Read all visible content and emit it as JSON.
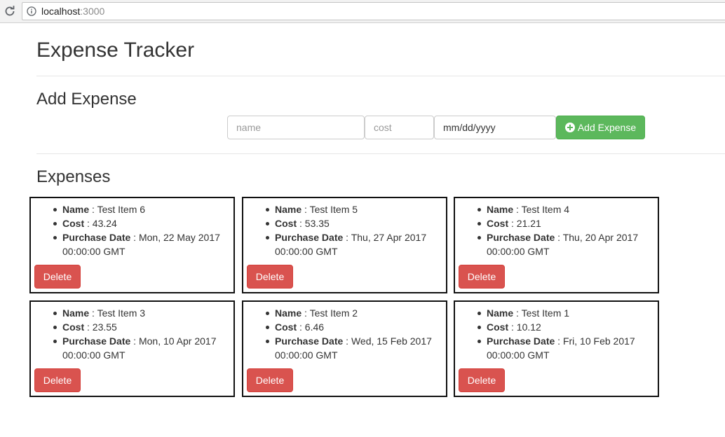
{
  "browser": {
    "url_host": "localhost",
    "url_port": ":3000"
  },
  "app": {
    "title": "Expense Tracker"
  },
  "add_expense": {
    "heading": "Add Expense",
    "name_placeholder": "name",
    "cost_placeholder": "cost",
    "date_placeholder": "mm/dd/yyyy",
    "button_label": "Add Expense",
    "button_color": "#5cb85c"
  },
  "expenses": {
    "heading": "Expenses",
    "field_labels": {
      "name": "Name",
      "cost": "Cost",
      "date": "Purchase Date"
    },
    "separator": " : ",
    "delete_label": "Delete",
    "delete_color": "#d9534f",
    "items": [
      {
        "name": "Test Item 6",
        "cost": "43.24",
        "date": "Mon, 22 May 2017 00:00:00 GMT"
      },
      {
        "name": "Test Item 5",
        "cost": "53.35",
        "date": "Thu, 27 Apr 2017 00:00:00 GMT"
      },
      {
        "name": "Test Item 4",
        "cost": "21.21",
        "date": "Thu, 20 Apr 2017 00:00:00 GMT"
      },
      {
        "name": "Test Item 3",
        "cost": "23.55",
        "date": "Mon, 10 Apr 2017 00:00:00 GMT"
      },
      {
        "name": "Test Item 2",
        "cost": "6.46",
        "date": "Wed, 15 Feb 2017 00:00:00 GMT"
      },
      {
        "name": "Test Item 1",
        "cost": "10.12",
        "date": "Fri, 10 Feb 2017 00:00:00 GMT"
      }
    ]
  }
}
